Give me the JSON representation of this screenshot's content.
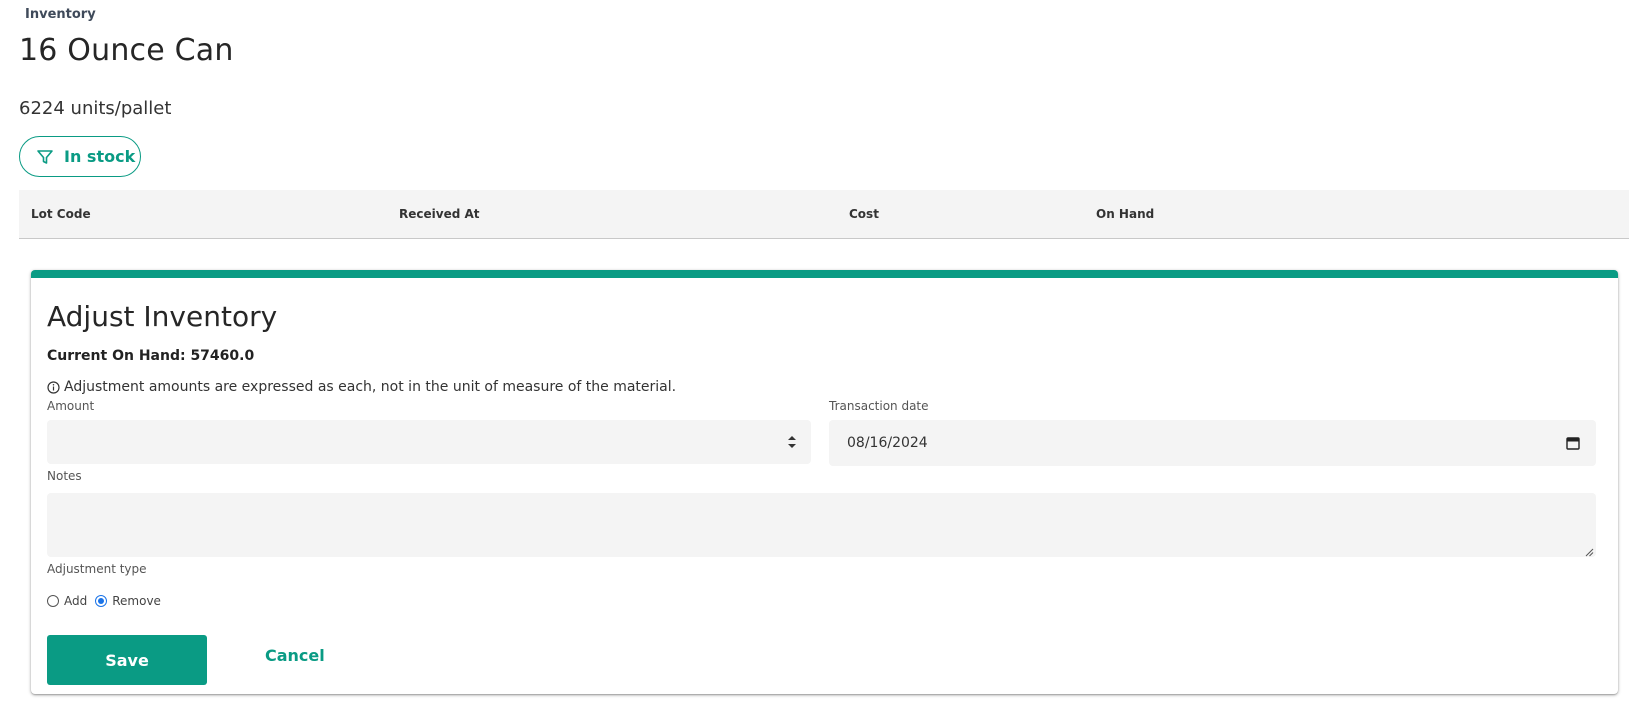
{
  "header": {
    "breadcrumb": "Inventory",
    "title": "16 Ounce Can",
    "units": "6224 units/pallet",
    "filter": {
      "label": "In stock",
      "icon": "filter-icon"
    }
  },
  "table": {
    "columns": [
      "Lot Code",
      "Received At",
      "Cost",
      "On Hand"
    ]
  },
  "adjust": {
    "title": "Adjust Inventory",
    "current_on_hand": "Current On Hand: 57460.0",
    "note": "Adjustment amounts are expressed as each, not in the unit of measure of the material.",
    "amount_label": "Amount",
    "amount_value": "",
    "date_label": "Transaction date",
    "date_value": "08/16/2024",
    "notes_label": "Notes",
    "notes_value": "",
    "type_label": "Adjustment type",
    "type_options": [
      "Add",
      "Remove"
    ],
    "type_selected": "Remove",
    "save_label": "Save",
    "cancel_label": "Cancel"
  },
  "colors": {
    "accent": "#0a9b84",
    "radio": "#1a73e8"
  }
}
